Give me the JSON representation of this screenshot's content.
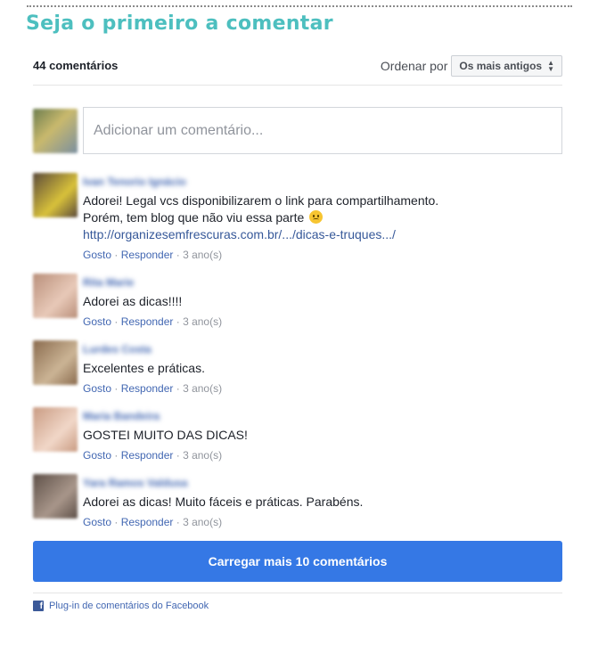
{
  "section_title": "Seja o primeiro a comentar",
  "header": {
    "count_label": "44 comentários",
    "sort_label": "Ordenar por",
    "sort_selected": "Os mais antigos"
  },
  "compose": {
    "placeholder": "Adicionar um comentário..."
  },
  "comments": [
    {
      "author": "Ivan Tenorio Ignácio",
      "lines": [
        "Adorei! Legal vcs disponibilizarem o link para compartilhamento.",
        "Porém, tem blog que não viu essa parte"
      ],
      "link": "http://organizesemfrescuras.com.br/.../dicas-e-truques.../",
      "like": "Gosto",
      "reply": "Responder",
      "time": "3 ano(s)",
      "avatar_colors": [
        "#5b4a3a",
        "#d8c13a"
      ]
    },
    {
      "author": "Rita Marie",
      "lines": [
        "Adorei as dicas!!!!"
      ],
      "like": "Gosto",
      "reply": "Responder",
      "time": "3 ano(s)",
      "avatar_colors": [
        "#b98f7a",
        "#e8c9b8"
      ]
    },
    {
      "author": "Lurdes Costa",
      "lines": [
        "Excelentes e práticas."
      ],
      "like": "Gosto",
      "reply": "Responder",
      "time": "3 ano(s)",
      "avatar_colors": [
        "#8a6b4e",
        "#cbb495"
      ]
    },
    {
      "author": "Maria Bandeira",
      "lines": [
        "GOSTEI MUITO DAS DICAS!"
      ],
      "like": "Gosto",
      "reply": "Responder",
      "time": "3 ano(s)",
      "avatar_colors": [
        "#c99b82",
        "#f1d7c8"
      ]
    },
    {
      "author": "Yara Ramos Valdusa",
      "lines": [
        "Adorei as dicas! Muito fáceis e práticas. Parabéns."
      ],
      "like": "Gosto",
      "reply": "Responder",
      "time": "3 ano(s)",
      "avatar_colors": [
        "#5e5048",
        "#a8968a"
      ]
    }
  ],
  "load_more_label": "Carregar mais 10 comentários",
  "footer_label": "Plug-in de comentários do Facebook",
  "colors": {
    "title": "#4dbfbf",
    "button": "#3578e5",
    "link": "#4267b2"
  }
}
